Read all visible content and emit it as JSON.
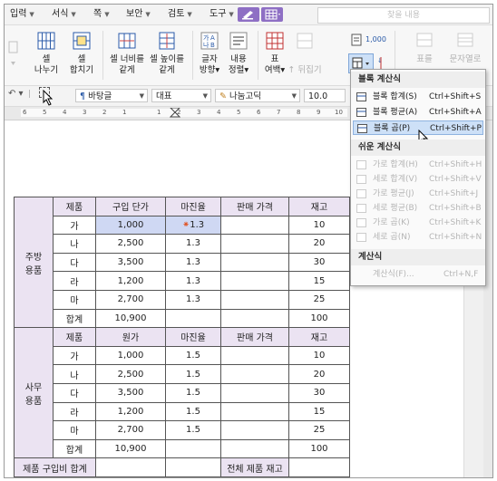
{
  "menu": {
    "items": [
      "입력",
      "서식",
      "쪽",
      "보안",
      "검토",
      "도구"
    ],
    "search_placeholder": "찾을 내용"
  },
  "ribbon": {
    "cell_split": "셀\n나누기",
    "cell_merge": "셀\n합치기",
    "equal_width": "셀 너비를\n같게",
    "equal_height": "셀 높이를\n같게",
    "text_direction": "글자\n방향",
    "content_align": "내용\n정렬",
    "table_margin": "표\n여백",
    "flip": "뒤집기",
    "table_right_1": "표를",
    "table_right_2": "문자열로"
  },
  "format_bar": {
    "style": "바탕글",
    "font_lang": "대표",
    "font_name": "나눔고딕",
    "font_size": "10.0",
    "unit": "pt"
  },
  "ruler": {
    "numbers": [
      "6",
      "5",
      "4",
      "3",
      "2",
      "1",
      "1",
      "2",
      "3",
      "4",
      "5",
      "6",
      "7",
      "8",
      "9",
      "10",
      "11"
    ]
  },
  "table": {
    "group1": {
      "category": "주방\n용품",
      "headers": [
        "제품",
        "구입 단가",
        "마진율",
        "판매 가격",
        "재고"
      ],
      "rows": [
        [
          "가",
          "1,000",
          "1.3",
          "",
          "10"
        ],
        [
          "나",
          "2,500",
          "1.3",
          "",
          "20"
        ],
        [
          "다",
          "3,500",
          "1.3",
          "",
          "30"
        ],
        [
          "라",
          "1,200",
          "1.3",
          "",
          "15"
        ],
        [
          "마",
          "2,700",
          "1.3",
          "",
          "25"
        ]
      ],
      "total": [
        "합계",
        "10,900",
        "",
        "",
        "100"
      ]
    },
    "group2": {
      "category": "사무\n용품",
      "headers": [
        "제품",
        "원가",
        "마진율",
        "판매 가격",
        "재고"
      ],
      "rows": [
        [
          "가",
          "1,000",
          "1.5",
          "",
          "10"
        ],
        [
          "나",
          "2,500",
          "1.5",
          "",
          "20"
        ],
        [
          "다",
          "3,500",
          "1.5",
          "",
          "30"
        ],
        [
          "라",
          "1,200",
          "1.5",
          "",
          "15"
        ],
        [
          "마",
          "2,700",
          "1.5",
          "",
          "25"
        ]
      ],
      "total": [
        "합계",
        "10,900",
        "",
        "",
        "100"
      ]
    },
    "footer": {
      "purchase_total": "제품 구입비 합계",
      "stock_total": "전체 제품 재고"
    }
  },
  "dropdown": {
    "section_block": "블록 계산식",
    "block_items": [
      {
        "label": "블록 합계(S)",
        "key": "Ctrl+Shift+S"
      },
      {
        "label": "블록 평균(A)",
        "key": "Ctrl+Shift+A"
      },
      {
        "label": "블록 곱(P)",
        "key": "Ctrl+Shift+P"
      }
    ],
    "section_easy": "쉬운 계산식",
    "easy_items": [
      {
        "label": "가로 합계(H)",
        "key": "Ctrl+Shift+H"
      },
      {
        "label": "세로 합계(V)",
        "key": "Ctrl+Shift+V"
      },
      {
        "label": "가로 평균(J)",
        "key": "Ctrl+Shift+J"
      },
      {
        "label": "세로 평균(B)",
        "key": "Ctrl+Shift+B"
      },
      {
        "label": "가로 곱(K)",
        "key": "Ctrl+Shift+K"
      },
      {
        "label": "세로 곱(N)",
        "key": "Ctrl+Shift+N"
      }
    ],
    "section_calc": "계산식",
    "calc_item": {
      "label": "계산식(F)...",
      "key": "Ctrl+N,F"
    }
  }
}
